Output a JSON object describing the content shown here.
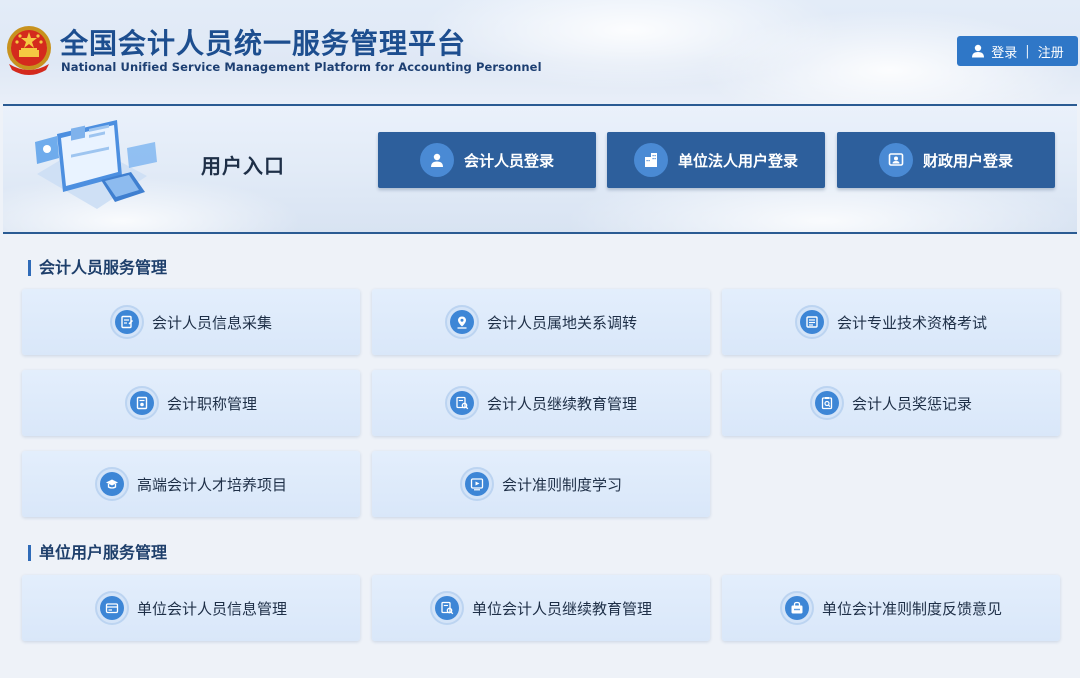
{
  "header": {
    "title_cn": "全国会计人员统一服务管理平台",
    "title_en": "National Unified Service Management Platform for Accounting Personnel",
    "login_label": "登录",
    "separator": "|",
    "register_label": "注册"
  },
  "entry": {
    "title": "用户入口",
    "buttons": [
      {
        "label": "会计人员登录",
        "icon": "person-icon"
      },
      {
        "label": "单位法人用户登录",
        "icon": "building-icon"
      },
      {
        "label": "财政用户登录",
        "icon": "finance-user-icon"
      }
    ]
  },
  "sections": [
    {
      "title": "会计人员服务管理",
      "cards": [
        {
          "label": "会计人员信息采集",
          "icon": "info-collect-icon"
        },
        {
          "label": "会计人员属地关系调转",
          "icon": "location-transfer-icon"
        },
        {
          "label": "会计专业技术资格考试",
          "icon": "exam-icon"
        },
        {
          "label": "会计职称管理",
          "icon": "title-manage-icon"
        },
        {
          "label": "会计人员继续教育管理",
          "icon": "education-search-icon"
        },
        {
          "label": "会计人员奖惩记录",
          "icon": "reward-record-icon"
        },
        {
          "label": "高端会计人才培养项目",
          "icon": "graduation-cap-icon"
        },
        {
          "label": "会计准则制度学习",
          "icon": "video-play-icon"
        }
      ]
    },
    {
      "title": "单位用户服务管理",
      "cards": [
        {
          "label": "单位会计人员信息管理",
          "icon": "card-info-icon"
        },
        {
          "label": "单位会计人员继续教育管理",
          "icon": "education-search-icon"
        },
        {
          "label": "单位会计准则制度反馈意见",
          "icon": "feedback-icon"
        }
      ]
    }
  ],
  "colors": {
    "brand": "#1d4e8f",
    "login_button": "#2d5f9c",
    "auth_button": "#2f77c7",
    "card_bg": "#dde9fa",
    "icon_accent": "#3d86d6"
  }
}
